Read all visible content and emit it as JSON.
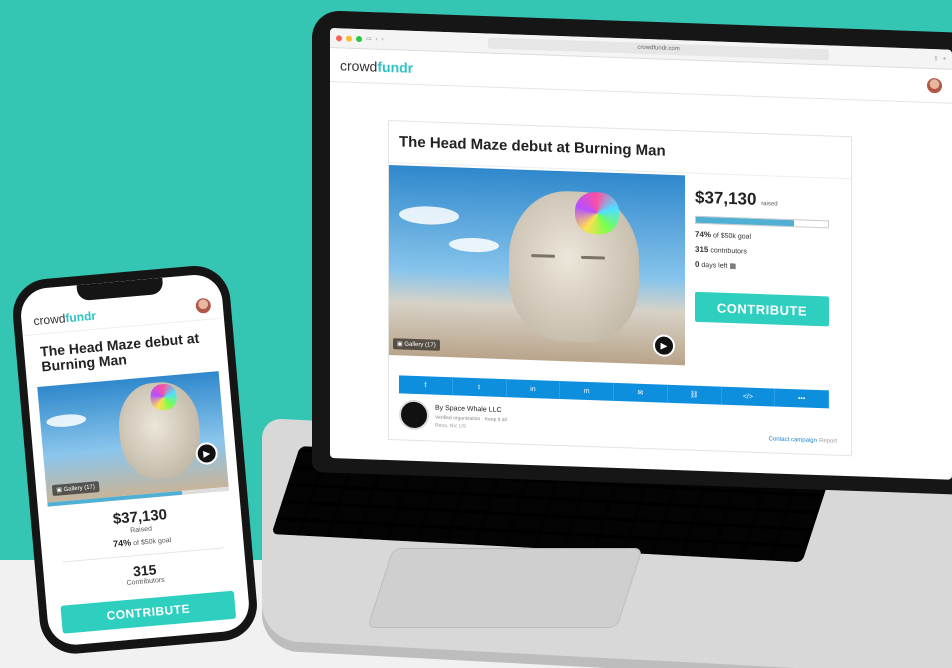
{
  "colors": {
    "teal_bg": "#35c5b3",
    "accent": "#2fcfc0",
    "share_blue": "#0e8fde",
    "progress": "#4fb0d4"
  },
  "browser": {
    "url": "crowdfundr.com"
  },
  "brand": {
    "logo_prefix": "crowd",
    "logo_suffix": "fundr"
  },
  "campaign": {
    "title": "The Head Maze debut at Burning Man",
    "amount": "$37,130",
    "raised_label": "raised",
    "progress": 0.74,
    "goal_pct": "74%",
    "goal_text": "of $50k goal",
    "contributors": "315",
    "contributors_label": "contributors",
    "days_left": "0",
    "days_label": "days left",
    "gallery_label": "Gallery (17)",
    "contribute_label": "CONTRIBUTE"
  },
  "share_icons": [
    "facebook-icon",
    "twitter-icon",
    "linkedin-icon",
    "messenger-icon",
    "email-icon",
    "link-icon",
    "embed-icon",
    "more-icon"
  ],
  "share_glyphs": [
    "f",
    "t",
    "in",
    "m",
    "✉",
    "⛓",
    "</>",
    "•••"
  ],
  "organizer": {
    "by_label": "By Space Whale LLC",
    "verified": "Verified organization · Keep it all",
    "location": "Reno, NV, US",
    "contact_label": "Contact campaign",
    "report_label": "Report"
  },
  "mobile": {
    "title": "The Head Maze debut at Burning Man",
    "amount": "$37,130",
    "raised_label": "Raised",
    "goal_pct": "74%",
    "goal_text": "of $50k goal",
    "contributors": "315",
    "contributors_label": "Contributors",
    "gallery_label": "Gallery (17)",
    "contribute_label": "CONTRIBUTE"
  }
}
